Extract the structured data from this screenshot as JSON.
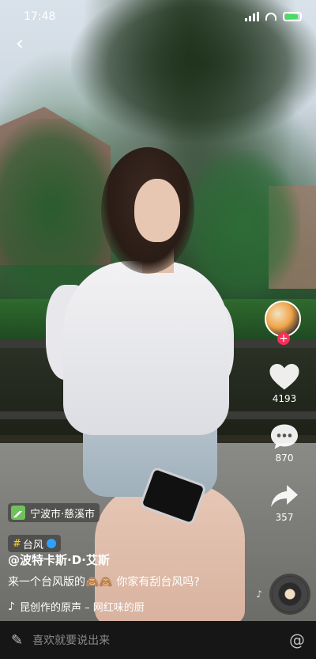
{
  "status_bar": {
    "time": "17:48",
    "battery_color": "#4cd964"
  },
  "video": {
    "description": "woman sitting outdoors with phone",
    "icon": "video-background"
  },
  "author": {
    "avatar_icon": "avatar",
    "follow_symbol": "+"
  },
  "actions": {
    "like_count": "4193",
    "comment_count": "870",
    "share_count": "357"
  },
  "location": {
    "label": "宁波市·慈溪市"
  },
  "topic": {
    "hash": "#",
    "label": "台风"
  },
  "post": {
    "username": "@波特卡斯·D·艾斯",
    "caption": "来一个台风版的🙈🙈 你家有刮台风吗?"
  },
  "music": {
    "title": "昆创作的原声 – 网红味的厨"
  },
  "comment_bar": {
    "placeholder": "喜欢就要说出来",
    "at_symbol": "@"
  },
  "colors": {
    "accent": "#fe2c55",
    "topic": "#ffd12e"
  }
}
